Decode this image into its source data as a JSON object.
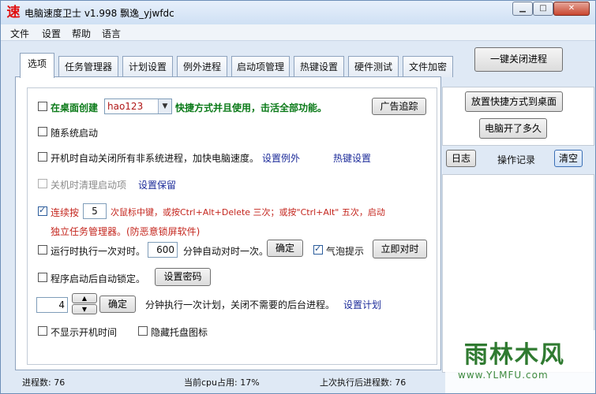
{
  "window": {
    "app_icon": "速",
    "title": "电脑速度卫士 v1.998 飘逸_yjwfdc",
    "min_symbol": "▁",
    "max_symbol": "□",
    "close_symbol": "✕"
  },
  "menu": [
    "文件",
    "设置",
    "帮助",
    "语言"
  ],
  "tabs": [
    "选项",
    "任务管理器",
    "计划设置",
    "例外进程",
    "启动项管理",
    "热键设置",
    "硬件测试",
    "文件加密"
  ],
  "top_button": "一键关闭进程",
  "options": {
    "desktop_label": "在桌面创建",
    "desktop_select": "hao123",
    "desktop_suffix": "快捷方式并且使用，击活全部功能。",
    "ad_button": "广告追踪",
    "autostart": "随系统启动",
    "close_nonsystem": "开机时自动关闭所有非系统进程，加快电脑速度。",
    "set_exception": "设置例外",
    "hotkey_link": "热键设置",
    "clean_startup": "关机时清理启动项",
    "set_keep": "设置保留",
    "mouse_prefix": "连续按",
    "mouse_count": "5",
    "mouse_suffix": "次鼠标中键，或按Ctrl+Alt+Delete 三次；或按\"Ctrl+Alt\" 五次，启动",
    "mouse_line2": "独立任务管理器。(防恶意锁屏软件)",
    "time_sync": "运行时执行一次对时。",
    "time_sync_minutes": "600",
    "time_sync_suffix": "分钟自动对时一次。",
    "ok_button": "确定",
    "bubble_tip": "气泡提示",
    "sync_now": "立即对时",
    "lock_after": "程序启动后自动锁定。",
    "set_password": "设置密码",
    "plan_minutes": "4",
    "plan_ok": "确定",
    "plan_text": "分钟执行一次计划，关闭不需要的后台进程。",
    "set_plan": "设置计划",
    "hide_boot_time": "不显示开机时间",
    "hide_tray": "隐藏托盘图标"
  },
  "right": {
    "shortcut_button": "放置快捷方式到桌面",
    "uptime_button": "电脑开了多久",
    "log_button": "日志",
    "oplog_label": "操作记录",
    "clear_button": "清空"
  },
  "status": {
    "process_count": "进程数: 76",
    "cpu": "当前cpu占用: 17%",
    "after_count": "上次执行后进程数: 76"
  },
  "watermark": {
    "brand": "雨林木风",
    "url": "www.YLMFU.com"
  }
}
